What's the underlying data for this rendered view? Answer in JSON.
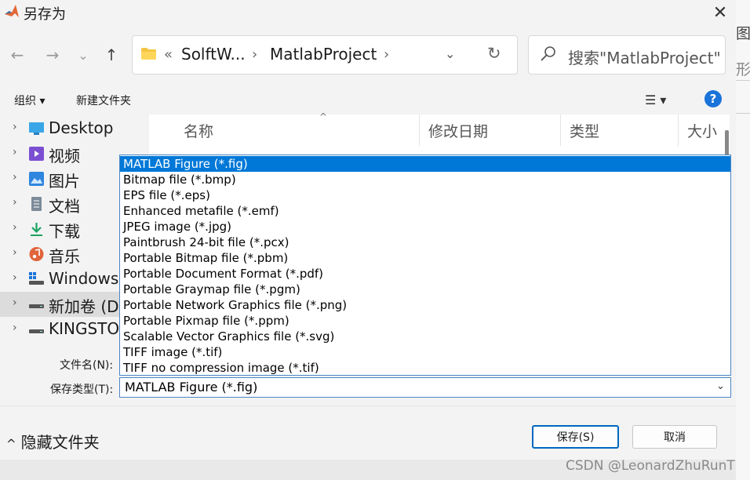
{
  "window": {
    "title": "另存为",
    "close": "✕"
  },
  "nav": {
    "back": "←",
    "forward": "→",
    "recent": "⌄",
    "up": "↑"
  },
  "address": {
    "overflow": "«",
    "crumbs": [
      "SolftW...",
      "MatlabProject"
    ],
    "chevron": "›",
    "dropdown": "⌄",
    "refresh": "↻"
  },
  "search": {
    "placeholder": "搜索\"MatlabProject\""
  },
  "toolbar": {
    "organize": "组织 ▾",
    "new_folder": "新建文件夹",
    "view": "☰ ▾",
    "help": "?"
  },
  "nav_pane": {
    "items": [
      {
        "label": "Desktop",
        "icon": "desktop-icon",
        "color": "#3aa6e8"
      },
      {
        "label": "视频",
        "icon": "video-icon",
        "color": "#7b4fd1"
      },
      {
        "label": "图片",
        "icon": "pictures-icon",
        "color": "#2e86de"
      },
      {
        "label": "文档",
        "icon": "documents-icon",
        "color": "#7d8b99"
      },
      {
        "label": "下载",
        "icon": "download-icon",
        "color": "#1aa260"
      },
      {
        "label": "音乐",
        "icon": "music-icon",
        "color": "#e0643c"
      },
      {
        "label": "Windows",
        "icon": "drive-icon",
        "color": "#555555"
      },
      {
        "label": "新加卷 (D:",
        "icon": "drive-icon",
        "color": "#555555"
      },
      {
        "label": "KINGSTO",
        "icon": "drive-icon",
        "color": "#555555"
      }
    ],
    "selected_index": 7
  },
  "columns": [
    "名称",
    "修改日期",
    "类型",
    "大小"
  ],
  "file_types": {
    "options": [
      "MATLAB Figure (*.fig)",
      "Bitmap file (*.bmp)",
      "EPS file (*.eps)",
      "Enhanced metafile (*.emf)",
      "JPEG image (*.jpg)",
      "Paintbrush 24-bit file (*.pcx)",
      "Portable Bitmap file (*.pbm)",
      "Portable Document Format (*.pdf)",
      "Portable Graymap file (*.pgm)",
      "Portable Network Graphics file (*.png)",
      "Portable Pixmap file (*.ppm)",
      "Scalable Vector Graphics file (*.svg)",
      "TIFF image (*.tif)",
      "TIFF no compression image (*.tif)"
    ],
    "highlighted_index": 0,
    "selected_value": "MATLAB Figure (*.fig)"
  },
  "form": {
    "filename_label": "文件名(N):",
    "filetype_label": "保存类型(T):"
  },
  "footer": {
    "hide_folders": "隐藏文件夹",
    "save": "保存(S)",
    "cancel": "取消"
  },
  "background_fragments": [
    "图形",
    "形"
  ],
  "watermark": "CSDN @LeonardZhuRunT",
  "colors": {
    "accent": "#0078d7",
    "matlab_orange": "#e16737"
  }
}
